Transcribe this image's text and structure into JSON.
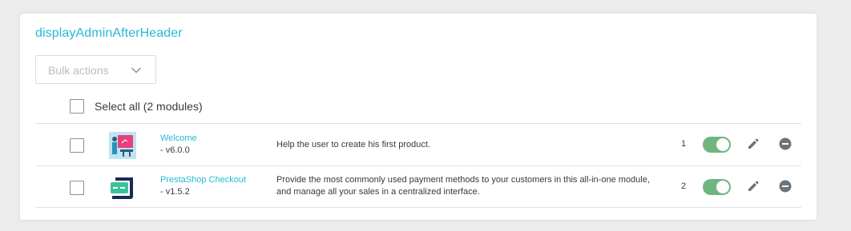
{
  "hook": {
    "title": "displayAdminAfterHeader"
  },
  "bulk_actions": {
    "label": "Bulk actions"
  },
  "select_all": {
    "label": "Select all (2 modules)"
  },
  "modules": [
    {
      "name": "Welcome",
      "version": "- v6.0.0",
      "description": "Help the user to create his first product.",
      "position": "1",
      "enabled": true,
      "logo_icon": "welcome-logo-icon"
    },
    {
      "name": "PrestaShop Checkout",
      "version": "- v1.5.2",
      "description": "Provide the most commonly used payment methods to your customers in this all-in-one module, and manage all your sales in a centralized interface.",
      "position": "2",
      "enabled": true,
      "logo_icon": "prestashop-checkout-logo-icon"
    }
  ],
  "colors": {
    "accent": "#25b9d7",
    "toggle_on": "#70b580",
    "icon_gray": "#6c737b",
    "background": "#ececed"
  }
}
